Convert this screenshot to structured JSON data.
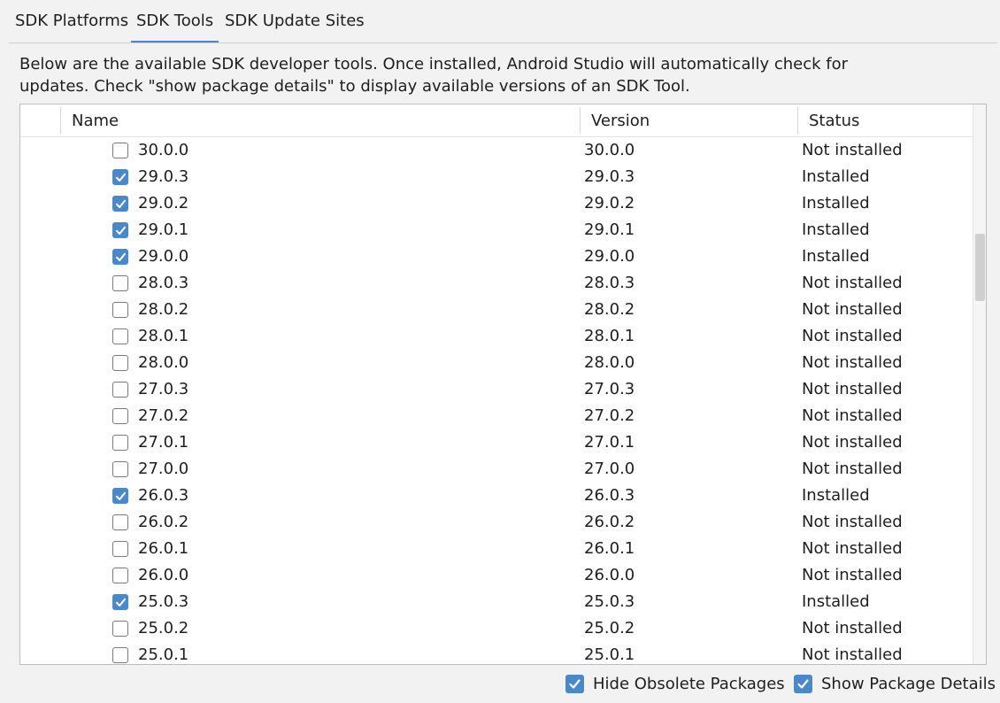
{
  "tabs": [
    {
      "label": "SDK Platforms",
      "active": false
    },
    {
      "label": "SDK Tools",
      "active": true
    },
    {
      "label": "SDK Update Sites",
      "active": false
    }
  ],
  "description": "Below are the available SDK developer tools. Once installed, Android Studio will automatically check for updates. Check \"show package details\" to display available versions of an SDK Tool.",
  "table": {
    "columns": [
      "Name",
      "Version",
      "Status"
    ],
    "rows": [
      {
        "name": "30.0.0",
        "version": "30.0.0",
        "status": "Not installed",
        "checked": false
      },
      {
        "name": "29.0.3",
        "version": "29.0.3",
        "status": "Installed",
        "checked": true
      },
      {
        "name": "29.0.2",
        "version": "29.0.2",
        "status": "Installed",
        "checked": true
      },
      {
        "name": "29.0.1",
        "version": "29.0.1",
        "status": "Installed",
        "checked": true
      },
      {
        "name": "29.0.0",
        "version": "29.0.0",
        "status": "Installed",
        "checked": true
      },
      {
        "name": "28.0.3",
        "version": "28.0.3",
        "status": "Not installed",
        "checked": false
      },
      {
        "name": "28.0.2",
        "version": "28.0.2",
        "status": "Not installed",
        "checked": false
      },
      {
        "name": "28.0.1",
        "version": "28.0.1",
        "status": "Not installed",
        "checked": false
      },
      {
        "name": "28.0.0",
        "version": "28.0.0",
        "status": "Not installed",
        "checked": false
      },
      {
        "name": "27.0.3",
        "version": "27.0.3",
        "status": "Not installed",
        "checked": false
      },
      {
        "name": "27.0.2",
        "version": "27.0.2",
        "status": "Not installed",
        "checked": false
      },
      {
        "name": "27.0.1",
        "version": "27.0.1",
        "status": "Not installed",
        "checked": false
      },
      {
        "name": "27.0.0",
        "version": "27.0.0",
        "status": "Not installed",
        "checked": false
      },
      {
        "name": "26.0.3",
        "version": "26.0.3",
        "status": "Installed",
        "checked": true
      },
      {
        "name": "26.0.2",
        "version": "26.0.2",
        "status": "Not installed",
        "checked": false
      },
      {
        "name": "26.0.1",
        "version": "26.0.1",
        "status": "Not installed",
        "checked": false
      },
      {
        "name": "26.0.0",
        "version": "26.0.0",
        "status": "Not installed",
        "checked": false
      },
      {
        "name": "25.0.3",
        "version": "25.0.3",
        "status": "Installed",
        "checked": true
      },
      {
        "name": "25.0.2",
        "version": "25.0.2",
        "status": "Not installed",
        "checked": false
      },
      {
        "name": "25.0.1",
        "version": "25.0.1",
        "status": "Not installed",
        "checked": false
      }
    ]
  },
  "options": {
    "hide_obsolete": {
      "label": "Hide Obsolete Packages",
      "checked": true
    },
    "show_details": {
      "label": "Show Package Details",
      "checked": true
    }
  },
  "colors": {
    "accent": "#4a88c7",
    "background": "#f2f2f2"
  }
}
